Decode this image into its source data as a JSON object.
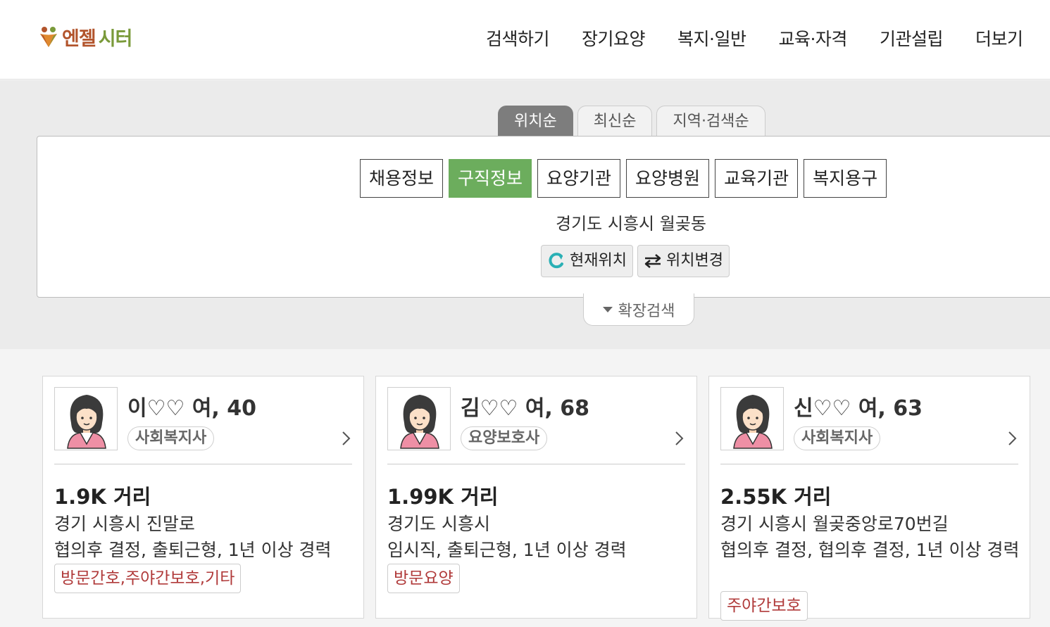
{
  "header": {
    "logo_primary": "엔젤",
    "logo_secondary": "시터",
    "nav": [
      "검색하기",
      "장기요양",
      "복지·일반",
      "교육·자격",
      "기관설립",
      "더보기"
    ]
  },
  "sort_tabs": [
    {
      "label": "위치순",
      "active": true
    },
    {
      "label": "최신순",
      "active": false
    },
    {
      "label": "지역·검색순",
      "active": false
    }
  ],
  "categories": [
    {
      "label": "채용정보",
      "active": false
    },
    {
      "label": "구직정보",
      "active": true
    },
    {
      "label": "요양기관",
      "active": false
    },
    {
      "label": "요양병원",
      "active": false
    },
    {
      "label": "교육기관",
      "active": false
    },
    {
      "label": "복지용구",
      "active": false
    }
  ],
  "location": {
    "text": "경기도 시흥시 월곶동",
    "current_label": "현재위치",
    "change_label": "위치변경",
    "expand_label": "확장검색"
  },
  "cards": [
    {
      "name": "이♡♡ 여, 40",
      "role": "사회복지사",
      "distance": "1.9K 거리",
      "address": "경기 시흥시 진말로",
      "terms": "협의후 결정, 출퇴근형, 1년 이상 경력",
      "tag": "방문간호,주야간보호,기타"
    },
    {
      "name": "김♡♡ 여, 68",
      "role": "요양보호사",
      "distance": "1.99K 거리",
      "address": "경기도 시흥시",
      "terms": "임시직, 출퇴근형, 1년 이상 경력",
      "tag": "방문요양"
    },
    {
      "name": "신♡♡ 여, 63",
      "role": "사회복지사",
      "distance": "2.55K 거리",
      "address": "경기 시흥시 월곶중앙로70번길",
      "terms": "협의후 결정, 협의후 결정, 1년 이상 경력",
      "tag": "주야간보호"
    }
  ],
  "colors": {
    "accent_green": "#6cad5d",
    "tag_red": "#b03a3a",
    "tab_active": "#7d7d7d"
  }
}
